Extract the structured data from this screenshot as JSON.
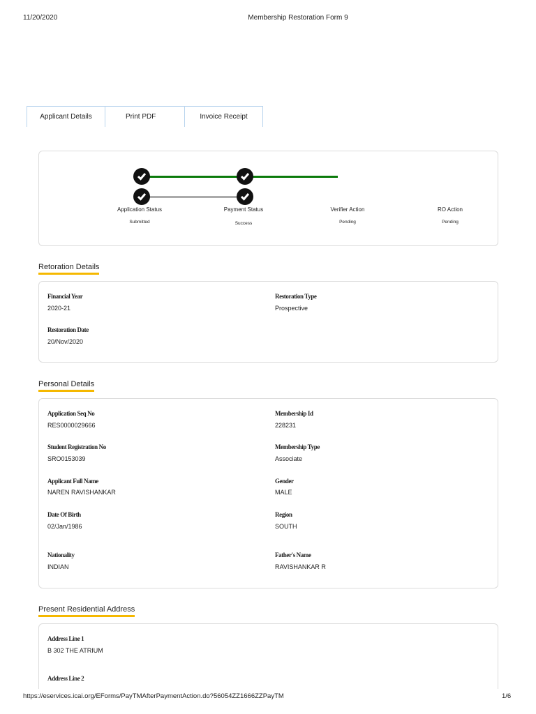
{
  "print_header": {
    "date": "11/20/2020",
    "title": "Membership Restoration Form 9"
  },
  "tabs": [
    {
      "label": "Applicant Details"
    },
    {
      "label": "Print PDF"
    },
    {
      "label": "Invoice Receipt"
    }
  ],
  "stepper": [
    {
      "label": "Application Status",
      "status": "Submitted"
    },
    {
      "label": "Payment Status",
      "status": "Success"
    },
    {
      "label": "Verifier Action",
      "status": "Pending"
    },
    {
      "label": "RO Action",
      "status": "Pending"
    }
  ],
  "restoration": {
    "title": "Retoration Details",
    "fields": [
      {
        "label": "Financial Year",
        "value": "2020-21"
      },
      {
        "label": "Restoration Type",
        "value": "Prospective"
      },
      {
        "label": "Restoration Date",
        "value": "20/Nov/2020"
      }
    ]
  },
  "personal": {
    "title": "Personal Details",
    "fields": [
      {
        "label": "Application Seq No",
        "value": "RES0000029666"
      },
      {
        "label": "Membership Id",
        "value": "228231"
      },
      {
        "label": "Student Registration No",
        "value": "SRO0153039"
      },
      {
        "label": "Membership Type",
        "value": "Associate"
      },
      {
        "label": "Applicant Full Name",
        "value": "NAREN RAVISHANKAR"
      },
      {
        "label": "Gender",
        "value": "MALE"
      },
      {
        "label": "Date Of Birth",
        "value": "02/Jan/1986"
      },
      {
        "label": "Region",
        "value": "SOUTH"
      },
      {
        "label": "Nationality",
        "value": "INDIAN"
      },
      {
        "label": "Father's Name",
        "value": "RAVISHANKAR R"
      }
    ]
  },
  "address": {
    "title": "Present Residential Address",
    "fields": [
      {
        "label": "Address Line 1",
        "value": "B 302 THE ATRIUM"
      },
      {
        "label": "Address Line 2",
        "value": ""
      }
    ]
  },
  "print_footer": {
    "url": "https://eservices.icai.org/EForms/PayTMAfterPaymentAction.do?56054ZZ1666ZZPayTM",
    "page": "1/6"
  },
  "colors": {
    "accent": "#f5b800",
    "progress": "#0a7a0a"
  }
}
